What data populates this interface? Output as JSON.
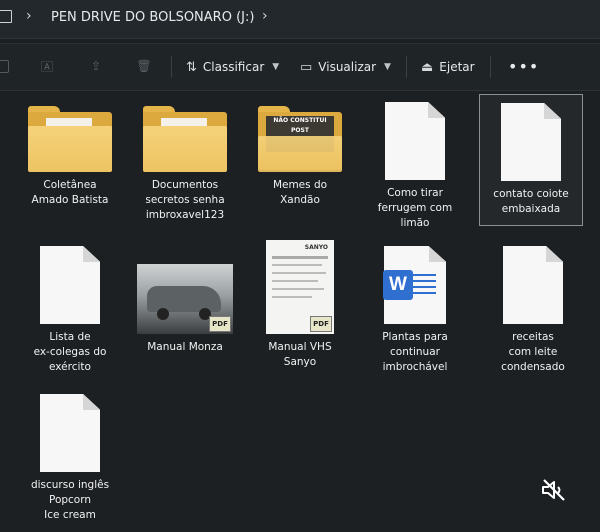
{
  "titlebar": {
    "path": "PEN DRIVE DO BOLSONARO (J:)"
  },
  "toolbar": {
    "sort_label": "Classificar",
    "view_label": "Visualizar",
    "eject_label": "Ejetar",
    "more_label": "•••"
  },
  "items": [
    {
      "label": "Coletânea\nAmado Batista",
      "kind": "folder"
    },
    {
      "label": "Documentos\nsecretos senha\nimbroxavel123",
      "kind": "folder"
    },
    {
      "label": "Memes do\nXandão",
      "kind": "folder",
      "thumb_text": "NÃO CONSTITUI POST"
    },
    {
      "label": "Como tirar\nferrugem com\nlimão",
      "kind": "document"
    },
    {
      "label": "contato coiote\nembaixada",
      "kind": "document",
      "selected": true
    },
    {
      "label": "Lista de\nex-colegas do\nexército",
      "kind": "document"
    },
    {
      "label": "Manual Monza",
      "kind": "pdf-image",
      "badge": "PDF"
    },
    {
      "label": "Manual VHS\nSanyo",
      "kind": "pdf-image",
      "badge": "PDF",
      "thumb_text": "SANYO"
    },
    {
      "label": "Plantas para\ncontinuar\nimbrochável",
      "kind": "word",
      "icon_letter": "W"
    },
    {
      "label": "receitas\ncom leite\ncondensado",
      "kind": "document"
    },
    {
      "label": "discurso inglês\nPopcorn\nIce cream",
      "kind": "document"
    }
  ],
  "colors": {
    "background": "#1c2023",
    "folder": "#edc462",
    "word_blue": "#2f6fd0"
  }
}
